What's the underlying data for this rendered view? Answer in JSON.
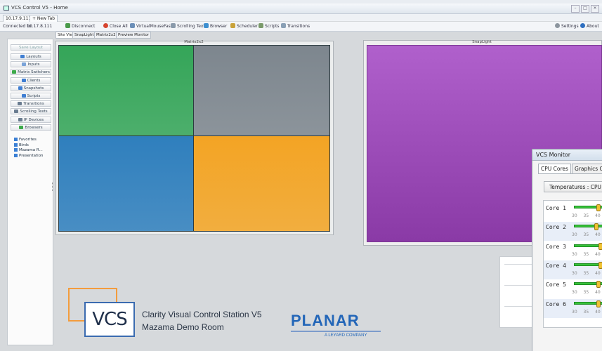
{
  "window": {
    "title": "VCS Control V5 - Home"
  },
  "tabs": [
    {
      "label": "10.17.9.111"
    },
    {
      "label": "+ New Tab"
    }
  ],
  "toolbar": {
    "connected_label": "Connected to:",
    "connected_ip": "10.17.8.111",
    "disconnect": "Disconnect",
    "close_all": "Close All",
    "virtual_mouse": "VirtualMouseFast",
    "scrolling_text": "Scrolling Text",
    "browser": "Browser",
    "scheduler": "Scheduler",
    "scripts": "Scripts",
    "transitions": "Transitions",
    "settings": "Settings",
    "about": "About"
  },
  "view_tabs": [
    "Site View",
    "SnapLight",
    "Matrix2x2",
    "Preview Monitor"
  ],
  "sidebar": {
    "save_layout": "Save Layout",
    "items": [
      {
        "label": "Layouts",
        "icon": "layout-icon",
        "color": "#3f7ed2"
      },
      {
        "label": "Inputs",
        "icon": "input-icon",
        "color": "#7aa3d8"
      },
      {
        "label": "Matrix Switchers",
        "icon": "matrix-icon",
        "color": "#3caa4a"
      },
      {
        "label": "Clients",
        "icon": "client-icon",
        "color": "#3f7ed2"
      },
      {
        "label": "Snapshots",
        "icon": "snapshot-icon",
        "color": "#3f7ed2"
      },
      {
        "label": "Scripts",
        "icon": "script-icon",
        "color": "#3f7ed2"
      },
      {
        "label": "Transitions",
        "icon": "transition-icon",
        "color": "#6a7c90"
      },
      {
        "label": "Scrolling Texts",
        "icon": "scroll-text-icon",
        "color": "#6a7c90"
      },
      {
        "label": "IP Devices",
        "icon": "ip-device-icon",
        "color": "#6a7c90"
      },
      {
        "label": "Browsers",
        "icon": "browser-icon",
        "color": "#3caa4a"
      }
    ],
    "layouts": [
      "Favorites",
      "Birds",
      "Mazama R...",
      "Presentation"
    ]
  },
  "wall": {
    "title": "Matrix2x2",
    "colors": [
      "#34a558",
      "#7d868e",
      "#2f7fbd",
      "#f3a424"
    ]
  },
  "snap": {
    "title": "SnapLight",
    "color": "#9c4db9"
  },
  "branding": {
    "vcs": "VCS",
    "line1": "Clarity Visual Control Station V5",
    "line2": "Mazama Demo Room",
    "planar": "PLANAR",
    "planar_sub": "A LEYARD COMPANY"
  },
  "monitor": {
    "title": "VCS Monitor",
    "tabs": [
      "CPU Cores",
      "Graphics C"
    ],
    "temp_button": "Temperatures : CPU",
    "ticks": "30 35 40",
    "cores": [
      {
        "label": "Core 1",
        "temp": 41
      },
      {
        "label": "Core 2",
        "temp": 40
      },
      {
        "label": "Core 3",
        "temp": 42
      },
      {
        "label": "Core 4",
        "temp": 42
      },
      {
        "label": "Core 5",
        "temp": 41
      },
      {
        "label": "Core 6",
        "temp": 41
      }
    ]
  }
}
